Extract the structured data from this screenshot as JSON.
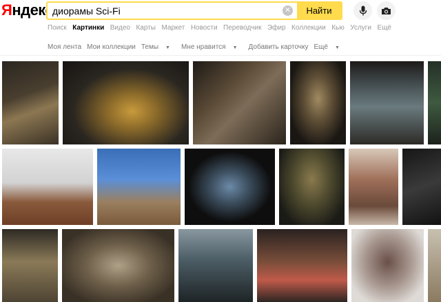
{
  "logo": {
    "first_letter": "Я",
    "rest": "ндекс"
  },
  "search": {
    "value": "диорамы Sci-Fi",
    "clear_glyph": "✕",
    "submit_label": "Найти"
  },
  "services": [
    "Поиск",
    "Картинки",
    "Видео",
    "Карты",
    "Маркет",
    "Новости",
    "Переводчик",
    "Эфир",
    "Коллекции",
    "Кью",
    "Услуги",
    "Ещё"
  ],
  "active_service": "Картинки",
  "subnav": [
    "Моя лента",
    "Мои коллекции",
    "Темы",
    "Мне нравится",
    "Добавить карточку",
    "Ещё"
  ],
  "colors": {
    "accent": "#ffdb4d",
    "logo_red": "#ff0000"
  },
  "icons": {
    "mic": "microphone-icon",
    "camera": "camera-icon"
  },
  "image_rows": [
    {
      "row": 1,
      "count": 7
    },
    {
      "row": 2,
      "count": 7
    },
    {
      "row": 3,
      "count": 6
    }
  ]
}
